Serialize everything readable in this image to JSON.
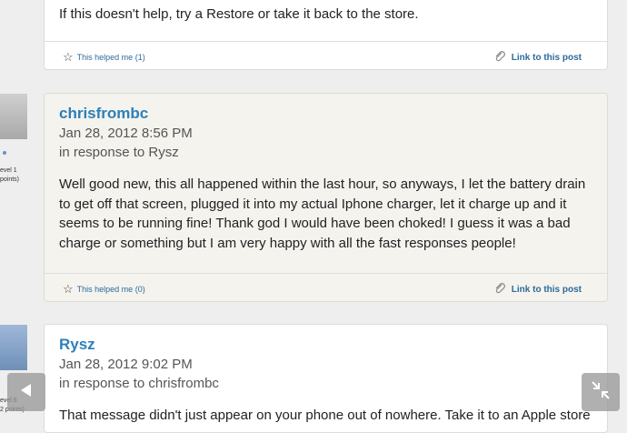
{
  "post_top": {
    "body": "If this doesn't help, try a Restore or take it back to the store.",
    "helped_label": "This helped me",
    "helped_count": "(1)",
    "link_label": "Link to this post"
  },
  "post_middle": {
    "side_level": "evel 1",
    "side_points": "points)",
    "author": "chrisfrombc",
    "date": "Jan 28, 2012 8:56 PM",
    "in_response": "in response to Rysz",
    "body": "Well good new, this all happened within the last hour, so anyways, I let the battery drain to get off that screen, plugged it into my actual Iphone charger, let it charge up and it seems to be running fine!  Thank god I would have been choked!  I guess it was a bad charge or something but I am very happy with all the fast responses people!",
    "helped_label": "This helped me",
    "helped_count": "(0)",
    "link_label": "Link to this post"
  },
  "post_bottom": {
    "side_level": "evel 6",
    "side_points": "2 points)",
    "author": "Rysz",
    "date": "Jan 28, 2012 9:02 PM",
    "in_response": "in response to chrisfrombc",
    "body": "That message didn't just appear on your phone out of nowhere. Take it to an Apple store"
  }
}
